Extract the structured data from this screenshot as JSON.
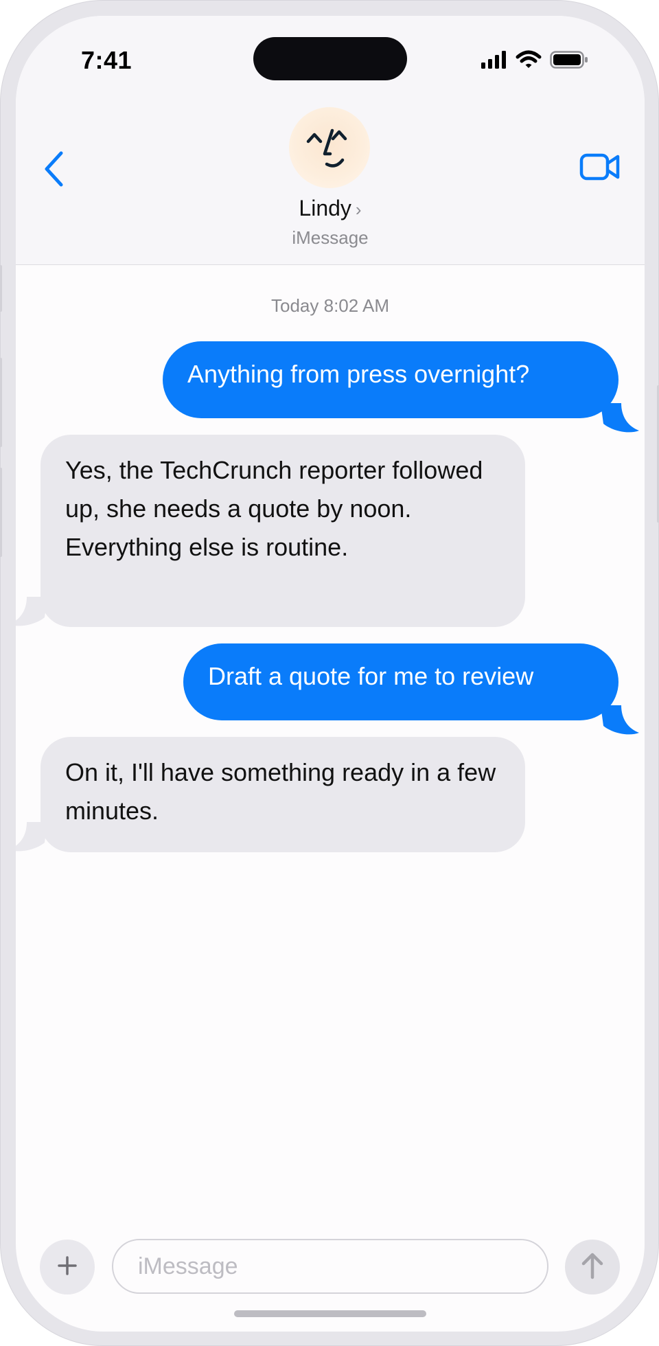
{
  "status_bar": {
    "time": "7:41",
    "icons": [
      "cellular-signal-icon",
      "wifi-icon",
      "battery-icon"
    ]
  },
  "header": {
    "back_icon": "chevron-left-icon",
    "contact_name": "Lindy",
    "contact_chevron": "›",
    "service": "iMessage",
    "video_icon": "video-camera-icon"
  },
  "conversation": {
    "timestamp": "Today 8:02 AM",
    "messages": [
      {
        "direction": "outgoing",
        "text": "Anything from press overnight?"
      },
      {
        "direction": "incoming",
        "text": "Yes, the TechCrunch reporter followed up, she needs a quote by noon. Everything else is routine."
      },
      {
        "direction": "outgoing",
        "text": "Draft a quote for me to review"
      },
      {
        "direction": "incoming",
        "text": "On it, I'll have something ready in a few minutes."
      }
    ]
  },
  "composer": {
    "plus_label": "+",
    "placeholder": "iMessage",
    "value": "",
    "send_icon": "arrow-up-icon"
  },
  "colors": {
    "accent": "#0a7cfa",
    "incoming_bubble": "#e9e8ed",
    "header_bg": "#f7f6f9"
  }
}
